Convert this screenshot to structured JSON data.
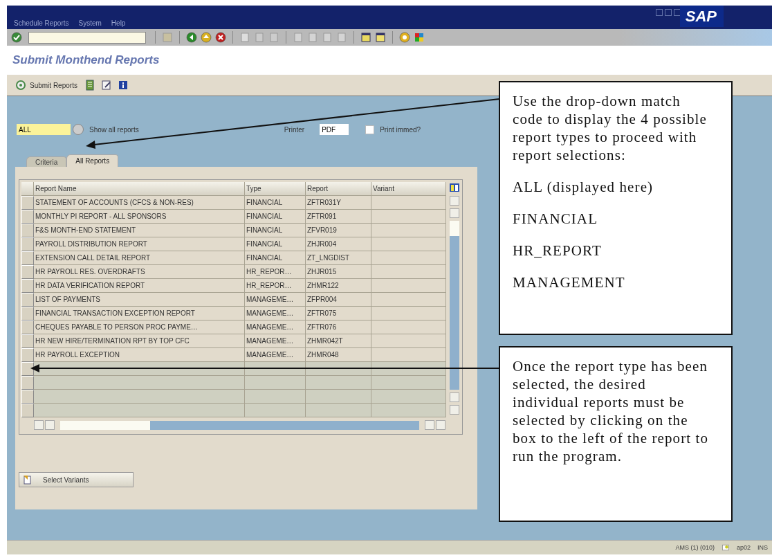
{
  "window": {
    "menu": [
      "Schedule Reports",
      "System",
      "Help"
    ],
    "logo": "SAP",
    "title": "Submit Monthend Reports"
  },
  "app_toolbar": {
    "submit_button": "Submit Reports"
  },
  "selection": {
    "report_type": "ALL",
    "description": "Show all reports",
    "printer_label": "Printer",
    "printer": "PDF",
    "print_immediately": {
      "label": "Print immed?",
      "checked": false
    }
  },
  "tabs": [
    {
      "label": "Criteria",
      "selected": false
    },
    {
      "label": "All Reports",
      "selected": true
    }
  ],
  "table": {
    "columns": [
      "Report Name",
      "Type",
      "Report",
      "Variant"
    ],
    "rows": [
      {
        "selected": false,
        "cells": [
          "STATEMENT OF ACCOUNTS (CFCS & NON-RES)",
          "FINANCIAL",
          "ZFTR031Y"
        ]
      },
      {
        "selected": false,
        "cells": [
          "MONTHLY PI REPORT - ALL SPONSORS",
          "FINANCIAL",
          "ZFTR091"
        ]
      },
      {
        "selected": false,
        "cells": [
          "F&S MONTH-END STATEMENT",
          "FINANCIAL",
          "ZFVR019"
        ]
      },
      {
        "selected": false,
        "cells": [
          "PAYROLL DISTRIBUTION REPORT",
          "FINANCIAL",
          "ZHJR004"
        ]
      },
      {
        "selected": false,
        "cells": [
          "EXTENSION CALL DETAIL REPORT",
          "FINANCIAL",
          "ZT_LNGDIST"
        ]
      },
      {
        "selected": false,
        "cells": [
          "HR PAYROLL RES. OVERDRAFTS",
          "HR_REPOR…",
          "ZHJR015"
        ]
      },
      {
        "selected": false,
        "cells": [
          "HR DATA VERIFICATION REPORT",
          "HR_REPOR…",
          "ZHMR122"
        ]
      },
      {
        "selected": false,
        "cells": [
          "LIST OF PAYMENTS",
          "MANAGEME…",
          "ZFPR004"
        ]
      },
      {
        "selected": false,
        "cells": [
          "FINANCIAL TRANSACTION EXCEPTION REPORT",
          "MANAGEME…",
          "ZFTR075"
        ]
      },
      {
        "selected": false,
        "cells": [
          "CHEQUES PAYABLE TO PERSON PROC PAYME…",
          "MANAGEME…",
          "ZFTR076"
        ]
      },
      {
        "selected": false,
        "cells": [
          "HR NEW HIRE/TERMINATION RPT BY TOP CFC",
          "MANAGEME…",
          "ZHMR042T"
        ]
      },
      {
        "selected": false,
        "cells": [
          "HR PAYROLL EXCEPTION",
          "MANAGEME…",
          "ZHMR048"
        ]
      }
    ]
  },
  "select_variants_button": "Select Variants",
  "status_bar": {
    "system": "AMS (1) (010)",
    "server": "ap02",
    "mode": "INS"
  },
  "callouts": [
    {
      "paragraphs": [
        "Use the drop-down match code to display the 4 possible report types to proceed with report selections:",
        "ALL (displayed here)",
        "FINANCIAL",
        "HR_REPORT",
        "MANAGEMENT"
      ]
    },
    {
      "paragraphs": [
        "Once the report type has been selected, the desired individual reports must be selected by clicking on the box to the left of the report to run the program."
      ]
    }
  ]
}
